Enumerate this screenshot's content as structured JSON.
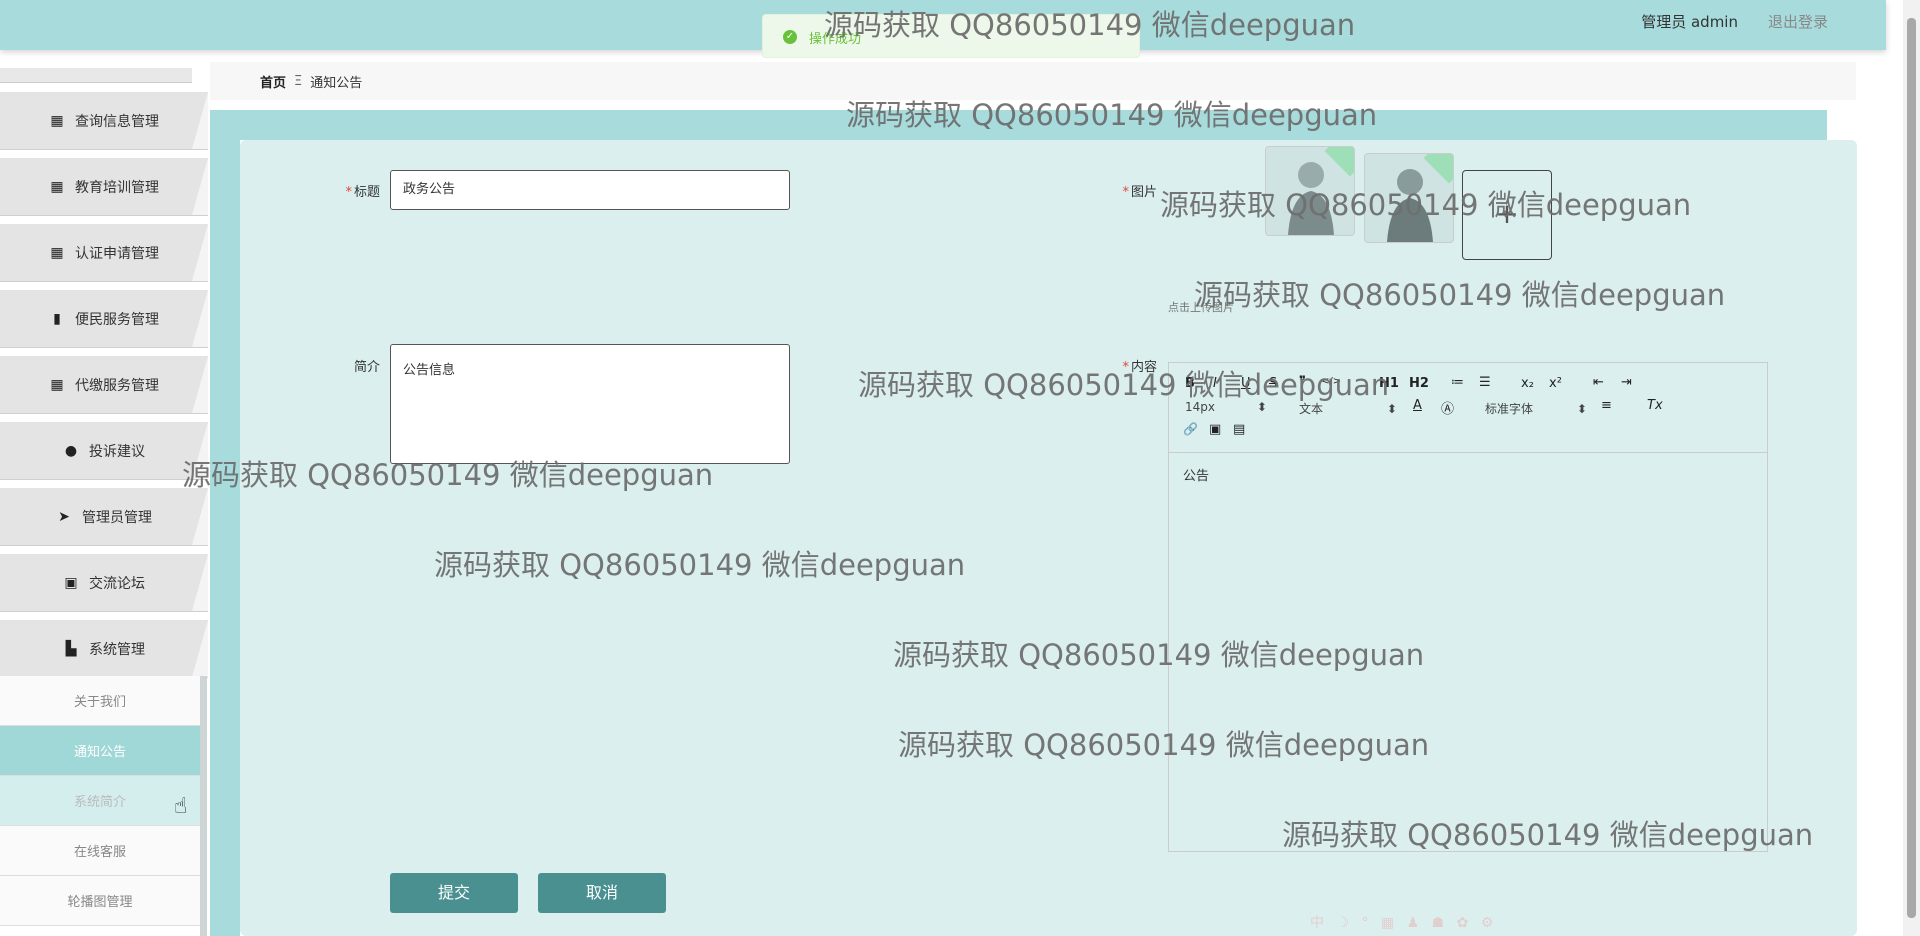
{
  "header": {
    "admin_label": "管理员 admin",
    "logout": "退出登录"
  },
  "toast": {
    "message": "操作成功"
  },
  "sidebar": {
    "items": [
      {
        "label": "查询信息管理",
        "icon": "grid-icon"
      },
      {
        "label": "教育培训管理",
        "icon": "grid-icon"
      },
      {
        "label": "认证申请管理",
        "icon": "grid-icon"
      },
      {
        "label": "便民服务管理",
        "icon": "bar-chart-icon"
      },
      {
        "label": "代缴服务管理",
        "icon": "grid-icon"
      },
      {
        "label": "投诉建议",
        "icon": "user-icon"
      },
      {
        "label": "管理员管理",
        "icon": "paper-plane-icon"
      },
      {
        "label": "交流论坛",
        "icon": "clipboard-check-icon"
      },
      {
        "label": "系统管理",
        "icon": "book-icon"
      }
    ],
    "subitems": [
      "关于我们",
      "通知公告",
      "系统简介",
      "在线客服",
      "轮播图管理"
    ]
  },
  "breadcrumb": {
    "home": "首页",
    "separator": "Ξ",
    "current": "通知公告"
  },
  "form": {
    "title_label": "标题",
    "title_value": "政务公告",
    "summary_label": "简介",
    "summary_value": "公告信息",
    "image_label": "图片",
    "upload_tip": "点击上传图片",
    "content_label": "内容",
    "content_value": "公告",
    "submit": "提交",
    "cancel": "取消"
  },
  "editor_toolbar": {
    "row1": [
      "B",
      "I",
      "U",
      "S",
      "❞",
      "</>",
      "H1",
      "H2",
      "≔",
      "☰",
      "x₂",
      "x²",
      "⇤",
      "⇥"
    ],
    "font_size": "14px",
    "header_select": "文本",
    "font_select": "标准字体",
    "align": "≡",
    "clean": "Tx",
    "row3": [
      "🔗",
      "▣",
      "▤"
    ]
  },
  "watermark": "源码获取 QQ86050149 微信deepguan",
  "ime_bar": "中 ☽ ° ▦ ♟ ☗ ✿ ⚙",
  "colors": {
    "header": "#a8dcdc",
    "card": "#dbefef",
    "button": "#4a9090",
    "active_sub": "#a0d8d8",
    "required": "#e64242"
  }
}
